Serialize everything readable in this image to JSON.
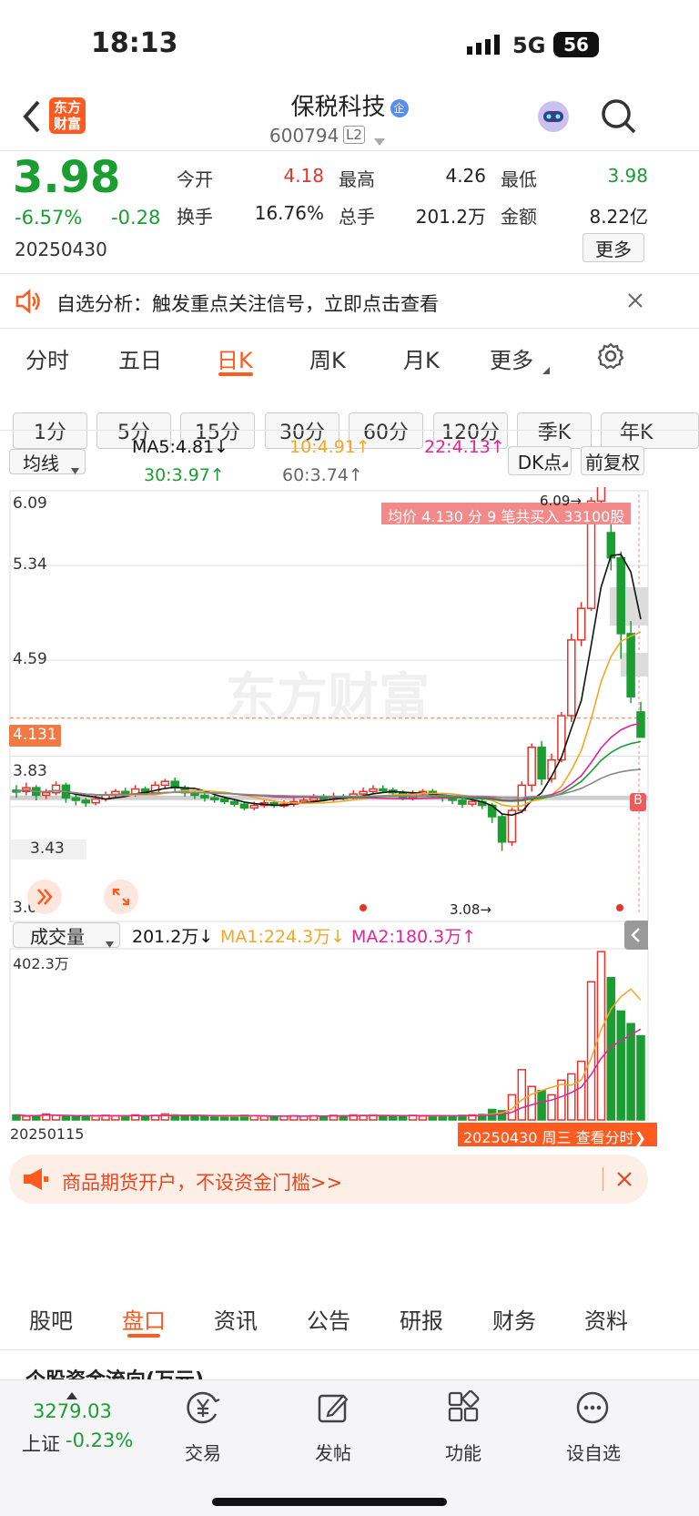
{
  "status_bar": {
    "time": "18:13",
    "network": "5G",
    "battery": "56"
  },
  "header": {
    "logo_text": "东方财富",
    "stock_name": "保税科技",
    "badge": "企",
    "stock_code": "600794",
    "level": "L2"
  },
  "quote": {
    "price": "3.98",
    "pct": "-6.57%",
    "change": "-0.28",
    "date": "20250430",
    "open_label": "今开",
    "open": "4.18",
    "high_label": "最高",
    "high": "4.26",
    "low_label": "最低",
    "low": "3.98",
    "turnover_label": "换手",
    "turnover": "16.76%",
    "volume_label": "总手",
    "volume": "201.2万",
    "amount_label": "金额",
    "amount": "8.22亿",
    "more": "更多"
  },
  "notice": {
    "text": "自选分析：触发重点关注信号，立即点击查看"
  },
  "period_tabs": [
    "分时",
    "五日",
    "日K",
    "周K",
    "月K",
    "更多"
  ],
  "active_tab": "日K",
  "interval_pills": [
    "1分",
    "5分",
    "15分",
    "30分",
    "60分",
    "120分",
    "季K",
    "年K"
  ],
  "ma_bar": {
    "selector": "均线",
    "ma5": "MA5:4.81↓",
    "ma10": "10:4.91↑",
    "ma22": "22:4.13↑",
    "ma30": "30:3.97↑",
    "ma60": "60:3.74↑",
    "dk": "DK点",
    "adjust": "前复权"
  },
  "chart": {
    "y_labels": [
      "6.09",
      "5.34",
      "4.59",
      "3.83",
      "3.43",
      "3.08"
    ],
    "current_price_label": "4.131",
    "tooltip": "均价 4.130 分 9 笔共买入 33100股",
    "high_mark": "6.09",
    "low_mark": "3.08",
    "b_badge": "B",
    "watermark": "东方财富"
  },
  "volume_bar": {
    "selector": "成交量",
    "vol": "201.2万↓",
    "ma1": "MA1:224.3万↓",
    "ma2": "MA2:180.3万↑",
    "max_label": "402.3万"
  },
  "date_axis": {
    "start": "20250115",
    "end": "20250430 周三 查看分时"
  },
  "ad": {
    "text": "商品期货开户，不设资金门槛>>"
  },
  "bottom_tabs": [
    "股吧",
    "盘口",
    "资讯",
    "公告",
    "研报",
    "财务",
    "资料"
  ],
  "active_bottom_tab": "盘口",
  "peek_text": "个股资金流向(万元)",
  "footer": {
    "index_value": "3279.03",
    "index_name": "上证",
    "index_change": "-0.23%",
    "trade": "交易",
    "post": "发帖",
    "func": "功能",
    "watch": "设自选"
  },
  "colors": {
    "up": "#e8332b",
    "down": "#1a9e32",
    "accent": "#ff5a1f",
    "ma5": "#111111",
    "ma10": "#f5a623",
    "ma22": "#e0259a",
    "ma30": "#1a9e32",
    "ma60": "#888888"
  }
}
